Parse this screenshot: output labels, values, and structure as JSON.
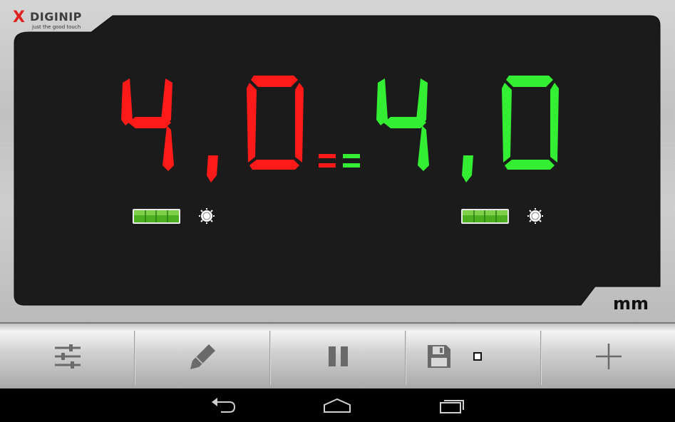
{
  "brand": {
    "logo_mark": "X",
    "name": "DIGINIP",
    "tagline": "just the good touch"
  },
  "display": {
    "left": {
      "digits": [
        "4",
        ",",
        "0"
      ],
      "color": "#ff1a1a",
      "level_icon": "bubble-level-icon",
      "brightness_icon": "brightness-icon"
    },
    "right": {
      "digits": [
        "4",
        ",",
        "0"
      ],
      "color": "#33ee33",
      "level_icon": "bubble-level-icon",
      "brightness_icon": "brightness-icon"
    },
    "equals_icon": "equals-icon",
    "unit": "mm"
  },
  "toolbar": {
    "items": [
      {
        "icon": "sliders-icon"
      },
      {
        "icon": "pencil-icon"
      },
      {
        "icon": "pause-icon"
      },
      {
        "icon": "save-icon",
        "checkbox_checked": false
      },
      {
        "icon": "plus-icon"
      }
    ]
  },
  "navbar": {
    "items": [
      "back-icon",
      "home-icon",
      "recent-apps-icon"
    ]
  }
}
